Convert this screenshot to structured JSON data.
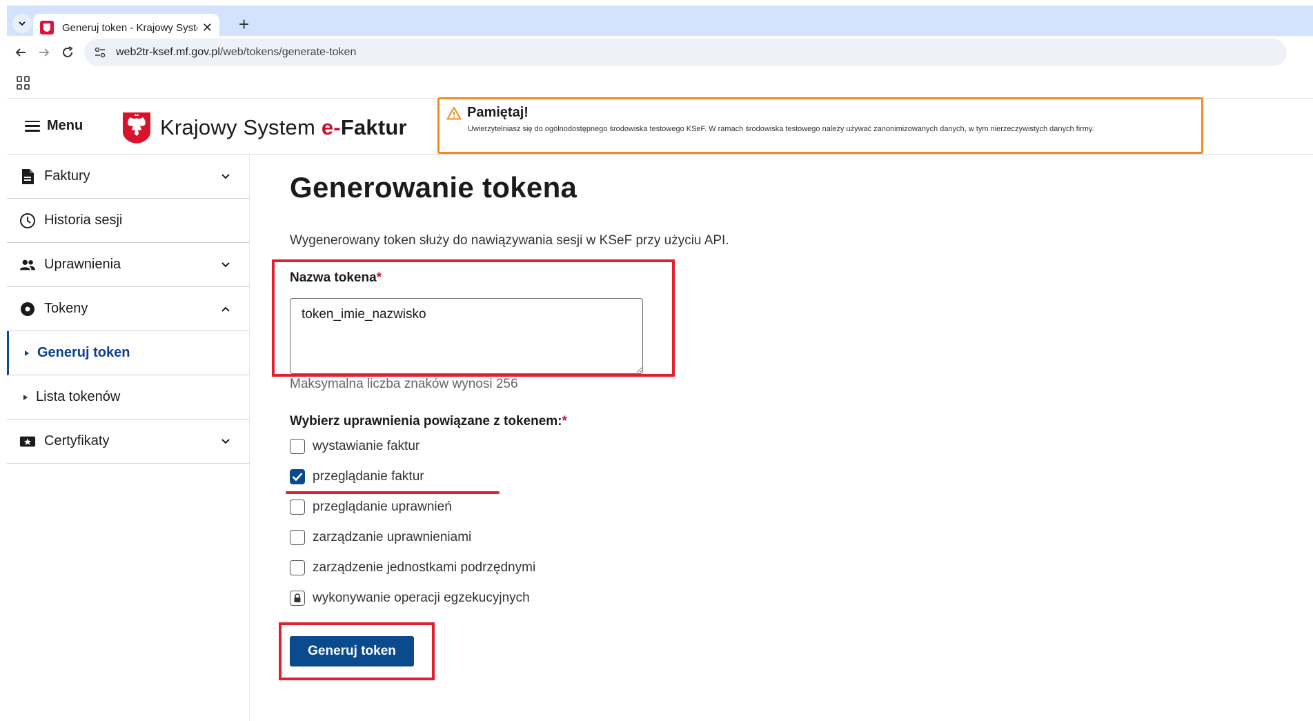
{
  "browser": {
    "tab_title": "Generuj token - Krajowy System e-Faktur",
    "tab_close": "✕",
    "new_tab": "+",
    "url_host": "web2tr-ksef.mf.gov.pl",
    "url_path": "/web/tokens/generate-token"
  },
  "header": {
    "menu_label": "Menu",
    "brand_main": "Krajowy System ",
    "brand_e": "e-",
    "brand_faktur": "Faktur",
    "notice_title": "Pamiętaj!",
    "notice_text": "Uwierzytelniasz się do ogólnodostępnego środowiska testowego KSeF. W ramach środowiska testowego należy używać zanonimizowanych danych, w tym nierzeczywistych danych firmy."
  },
  "sidebar": {
    "items": [
      {
        "label": "Faktury",
        "icon": "document-icon",
        "expanded": false
      },
      {
        "label": "Historia sesji",
        "icon": "clock-icon"
      },
      {
        "label": "Uprawnienia",
        "icon": "people-icon",
        "expanded": false
      },
      {
        "label": "Tokeny",
        "icon": "token-icon",
        "expanded": true
      },
      {
        "label": "Certyfikaty",
        "icon": "certificate-icon",
        "expanded": false
      }
    ],
    "sub_items": [
      {
        "label": "Generuj token",
        "active": true
      },
      {
        "label": "Lista tokenów",
        "active": false
      }
    ]
  },
  "main": {
    "title": "Generowanie tokena",
    "intro": "Wygenerowany token służy do nawiązywania sesji w KSeF przy użyciu API.",
    "token_name_label": "Nazwa tokena",
    "required_mark": "*",
    "token_name_value": "token_imie_nazwisko",
    "token_name_helper": "Maksymalna liczba znaków wynosi 256",
    "permissions_label": "Wybierz uprawnienia powiązane z tokenem:",
    "permissions": [
      {
        "label": "wystawianie faktur",
        "checked": false,
        "locked": false
      },
      {
        "label": "przeglądanie faktur",
        "checked": true,
        "locked": false
      },
      {
        "label": "przeglądanie uprawnień",
        "checked": false,
        "locked": false
      },
      {
        "label": "zarządzanie uprawnieniami",
        "checked": false,
        "locked": false
      },
      {
        "label": "zarządzenie jednostkami podrzędnymi",
        "checked": false,
        "locked": false
      },
      {
        "label": "wykonywanie operacji egzekucyjnych",
        "checked": false,
        "locked": true
      }
    ],
    "submit_label": "Generuj token"
  },
  "colors": {
    "primary": "#0b4a8c",
    "highlight": "#e0202e",
    "notice_border": "#f08a24",
    "brand_red": "#c8102e"
  }
}
